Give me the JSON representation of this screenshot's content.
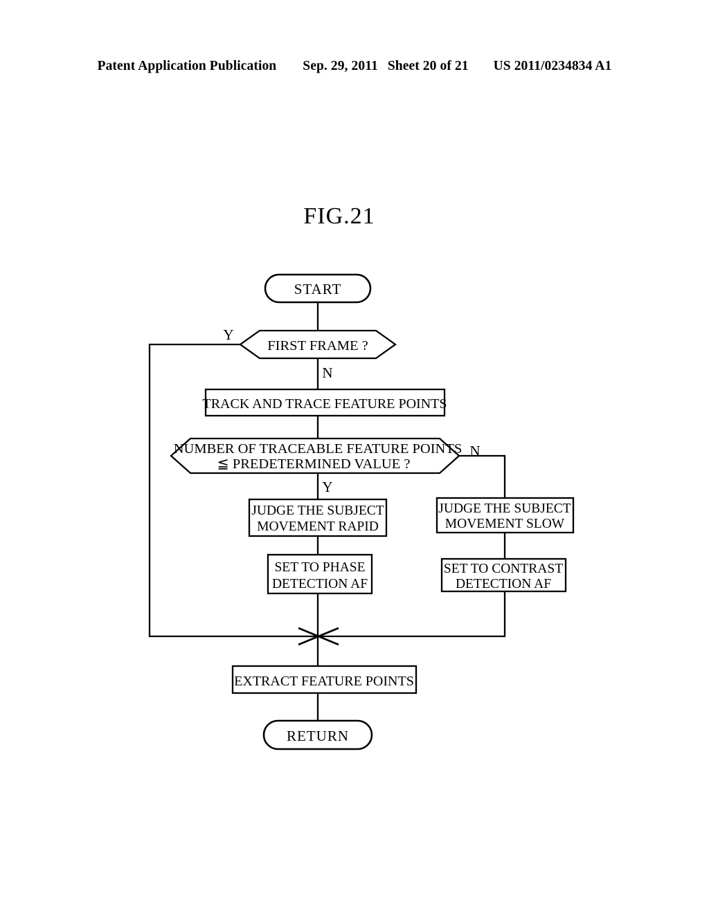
{
  "header": {
    "left": "Patent Application Publication",
    "date": "Sep. 29, 2011",
    "sheet": "Sheet 20 of 21",
    "pub_number": "US 2011/0234834 A1"
  },
  "figure": {
    "title": "FIG.21"
  },
  "flowchart": {
    "start": "START",
    "decision_first_frame": "FIRST FRAME ?",
    "first_frame_yes": "Y",
    "first_frame_no": "N",
    "track_trace": "TRACK AND TRACE FEATURE POINTS",
    "decision_count_line1": "NUMBER OF TRACEABLE FEATURE POINTS",
    "decision_count_line2": "≦ PREDETERMINED VALUE ?",
    "count_yes": "Y",
    "count_no": "N",
    "judge_rapid_line1": "JUDGE THE SUBJECT",
    "judge_rapid_line2": "MOVEMENT RAPID",
    "judge_slow_line1": "JUDGE THE SUBJECT",
    "judge_slow_line2": "MOVEMENT SLOW",
    "set_phase_line1": "SET TO PHASE",
    "set_phase_line2": "DETECTION AF",
    "set_contrast_line1": "SET TO CONTRAST",
    "set_contrast_line2": "DETECTION AF",
    "extract": "EXTRACT FEATURE POINTS",
    "return": "RETURN"
  },
  "colors": {
    "ink": "#000000",
    "paper": "#ffffff"
  }
}
